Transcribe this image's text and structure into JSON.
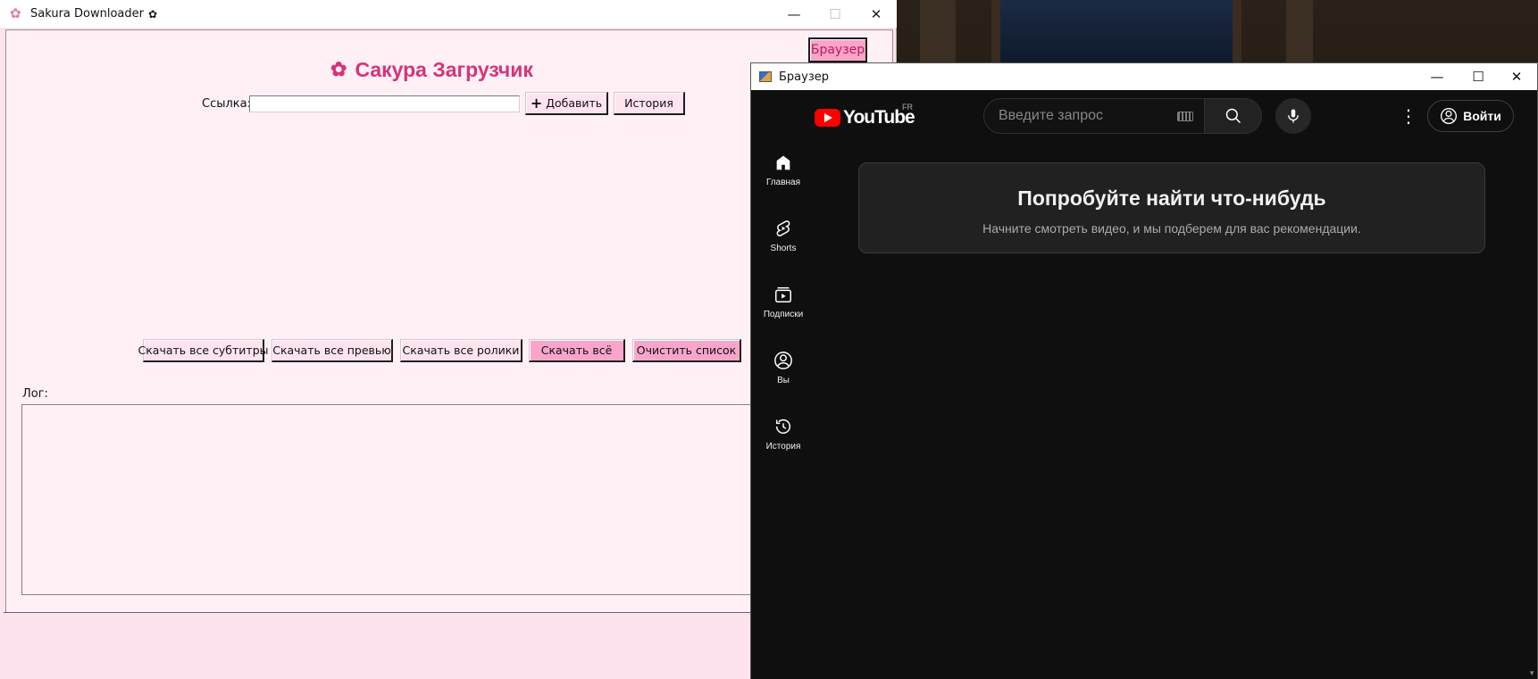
{
  "sakura_window": {
    "title": "Sakura Downloader",
    "title_flower": "✿",
    "controls": {
      "minimize": "—",
      "maximize": "☐",
      "close": "✕"
    },
    "browser_button": "Браузер",
    "heading": "Сакура Загрузчик",
    "url_label": "Ссылка:",
    "url_value": "",
    "add_button": "Добавить",
    "history_button": "История",
    "actions": [
      "Скачать все субтитры",
      "Скачать все превью",
      "Скачать все ролики",
      "Скачать всё",
      "Очистить список"
    ],
    "log_label": "Лог:",
    "colors": {
      "accent": "#d6337a",
      "pink_button": "#f9a5c9",
      "background": "#fff0f5"
    }
  },
  "browser_window": {
    "title": "Браузер",
    "controls": {
      "minimize": "—",
      "maximize": "☐",
      "close": "✕"
    },
    "youtube": {
      "logo_text": "YouTube",
      "region": "FR",
      "search_placeholder": "Введите запрос",
      "sign_in": "Войти",
      "nav": [
        {
          "label": "Главная",
          "icon": "home-icon"
        },
        {
          "label": "Shorts",
          "icon": "shorts-icon"
        },
        {
          "label": "Подписки",
          "icon": "subscriptions-icon"
        },
        {
          "label": "Вы",
          "icon": "you-icon"
        },
        {
          "label": "История",
          "icon": "history-icon"
        }
      ],
      "empty_title": "Попробуйте найти что-нибудь",
      "empty_subtitle": "Начните смотреть видео, и мы подберем для вас рекомендации."
    }
  }
}
